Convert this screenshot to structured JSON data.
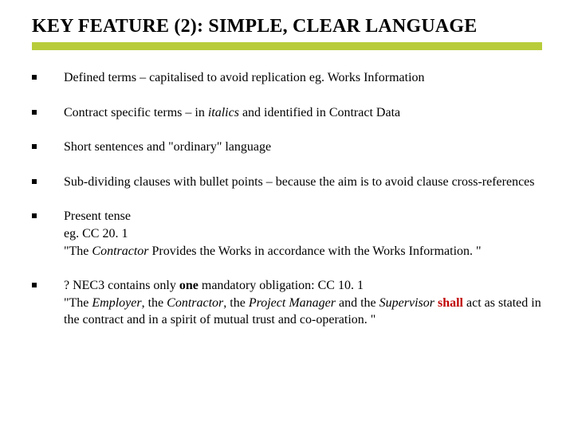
{
  "title": "KEY FEATURE (2): SIMPLE, CLEAR LANGUAGE",
  "accent_color": "#b8cc3a",
  "shall_color": "#c00000",
  "bullets": {
    "b1": {
      "pre": "Defined terms – capitalised to avoid replication eg. Works Information"
    },
    "b2": {
      "pre": "Contract specific terms – in ",
      "italic": "italics",
      "post": " and identified in Contract Data"
    },
    "b3": {
      "pre": "Short sentences and \"ordinary\" language"
    },
    "b4": {
      "pre": "Sub-dividing clauses with bullet points – because the aim is to avoid clause cross-references"
    },
    "b5": {
      "line1": "Present tense",
      "line2": "eg. CC 20. 1",
      "q_open": "\"The ",
      "role1": "Contractor",
      "mid": " Provides the Works in accordance with the Works Information. \""
    },
    "b6": {
      "q_pre": "? NEC3 contains only ",
      "one": "one",
      "q_mid": " mandatory obligation: CC 10. 1",
      "q2_open": "\"The ",
      "role_emp": "Employer",
      "c1": ", the ",
      "role_con": "Contractor",
      "c2": ", the ",
      "role_pm": "Project Manager",
      "c3": " and the ",
      "role_sup": "Supervisor",
      "sp": " ",
      "shall": "shall",
      "tail": " act as stated in the contract and in a spirit of mutual trust and co-operation. \""
    }
  }
}
